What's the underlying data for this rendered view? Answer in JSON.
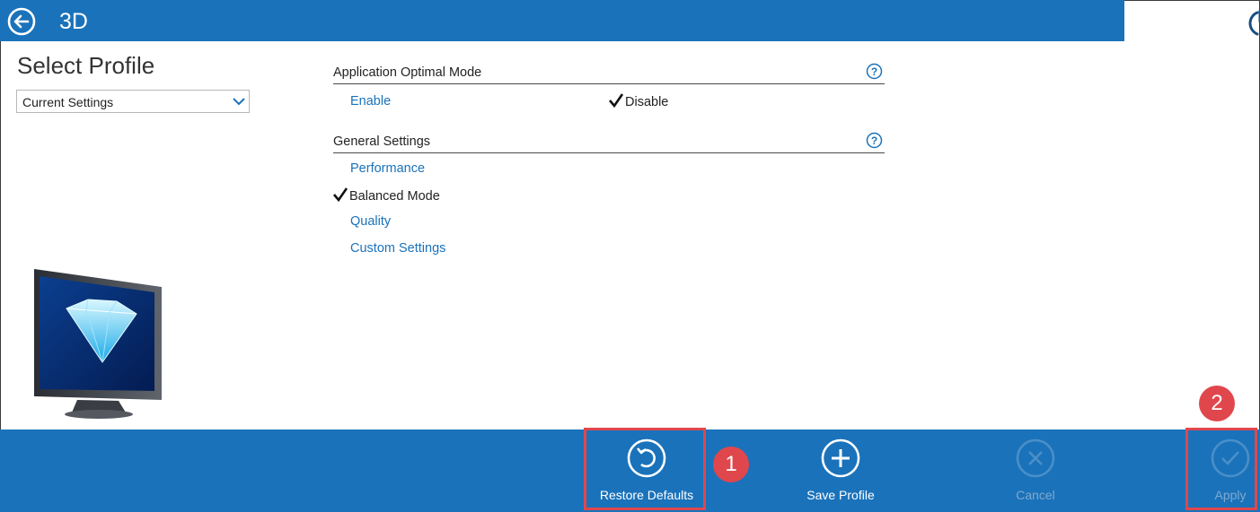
{
  "header": {
    "title": "3D"
  },
  "profile": {
    "heading": "Select Profile",
    "selected": "Current Settings"
  },
  "sections": {
    "app_mode": {
      "title": "Application Optimal Mode",
      "options": {
        "enable": "Enable",
        "disable": "Disable"
      },
      "selected": "Disable"
    },
    "general": {
      "title": "General Settings",
      "options": {
        "performance": "Performance",
        "balanced": "Balanced Mode",
        "quality": "Quality",
        "custom": "Custom Settings"
      },
      "selected": "Balanced Mode"
    }
  },
  "footer": {
    "restore": "Restore Defaults",
    "save": "Save Profile",
    "cancel": "Cancel",
    "apply": "Apply"
  },
  "annotations": {
    "one": "1",
    "two": "2"
  },
  "colors": {
    "accent": "#1a72ba",
    "highlight": "#e0474c",
    "disabled": "#7fa9cf"
  },
  "icons": {
    "back": "back-arrow-icon",
    "power": "power-icon",
    "help": "help-icon",
    "restore": "undo-icon",
    "save": "plus-icon",
    "cancel": "x-icon",
    "apply": "check-icon"
  }
}
